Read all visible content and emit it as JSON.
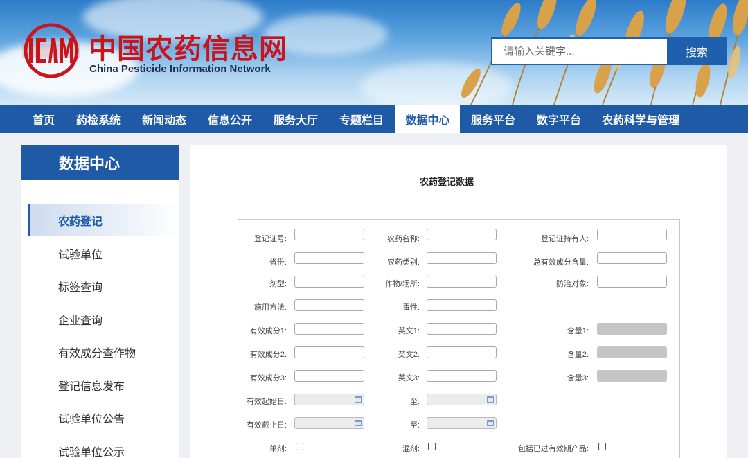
{
  "header": {
    "logo_cn": "中国农药信息网",
    "logo_en": "China Pesticide Information Network",
    "search_placeholder": "请输入关键字...",
    "search_button": "搜索"
  },
  "nav": [
    "首页",
    "药检系统",
    "新闻动态",
    "信息公开",
    "服务大厅",
    "专题栏目",
    "数据中心",
    "服务平台",
    "数字平台",
    "农药科学与管理"
  ],
  "nav_active": "数据中心",
  "sidebar": {
    "title": "数据中心",
    "items": [
      "农药登记",
      "试验单位",
      "标签查询",
      "企业查询",
      "有效成分查作物",
      "登记信息发布",
      "试验单位公告",
      "试验单位公示"
    ],
    "active": "农药登记"
  },
  "main": {
    "title": "农药登记数据",
    "fields": {
      "reg_no": "登记证号:",
      "name": "农药名称:",
      "holder": "登记证持有人:",
      "province": "省份:",
      "category": "农药类别:",
      "total_content": "总有效成分含量:",
      "formulation": "剂型:",
      "crop": "作物/场所:",
      "target": "防治对象:",
      "method": "施用方法:",
      "toxicity": "毒性:",
      "ingredient1": "有效成分1:",
      "english1": "英文1:",
      "content1": "含量1:",
      "ingredient2": "有效成分2:",
      "english2": "英文2:",
      "content2": "含量2:",
      "ingredient3": "有效成分3:",
      "english3": "英文3:",
      "content3": "含量3:",
      "start_date": "有效起始日:",
      "to1": "至:",
      "end_date": "有效截止日:",
      "to2": "至:",
      "single": "单剂:",
      "mixture": "混剂:",
      "include_expired": "包括已过有效期产品:"
    }
  },
  "colors": {
    "brand_blue": "#1f5aa6",
    "logo_red": "#c8141c"
  }
}
